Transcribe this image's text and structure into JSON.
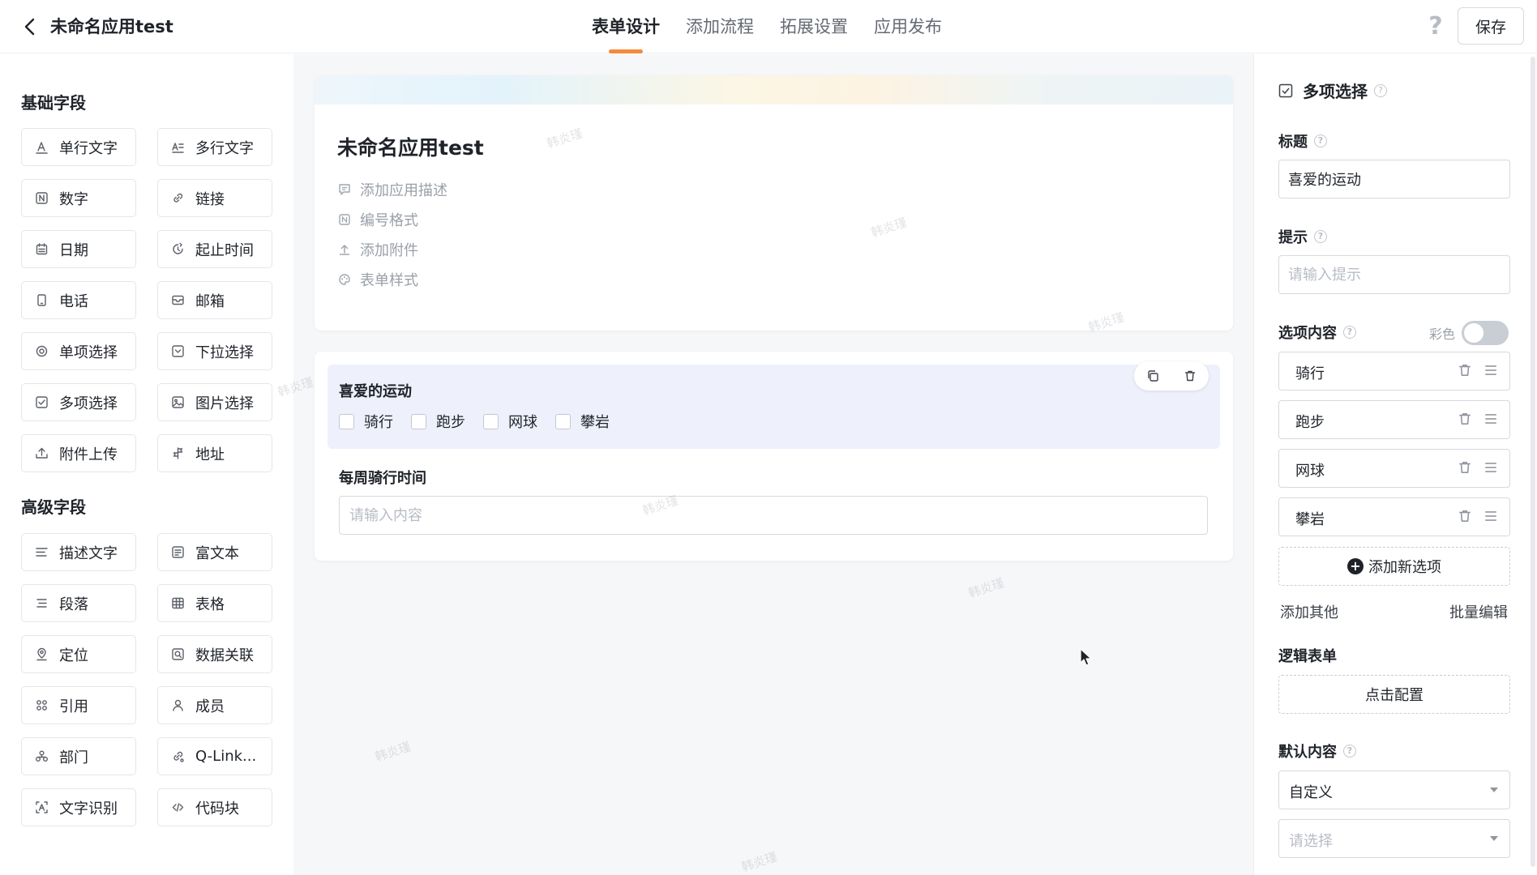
{
  "app": {
    "title": "未命名应用test"
  },
  "tabs": [
    {
      "label": "表单设计",
      "active": true
    },
    {
      "label": "添加流程",
      "active": false
    },
    {
      "label": "拓展设置",
      "active": false
    },
    {
      "label": "应用发布",
      "active": false
    }
  ],
  "toolbar": {
    "help": "?",
    "save_label": "保存"
  },
  "left": {
    "basic_title": "基础字段",
    "basic_fields": [
      {
        "label": "单行文字",
        "icon": "single-line-text-icon"
      },
      {
        "label": "多行文字",
        "icon": "multi-line-text-icon"
      },
      {
        "label": "数字",
        "icon": "number-icon"
      },
      {
        "label": "链接",
        "icon": "link-icon"
      },
      {
        "label": "日期",
        "icon": "calendar-icon"
      },
      {
        "label": "起止时间",
        "icon": "time-range-icon"
      },
      {
        "label": "电话",
        "icon": "phone-icon"
      },
      {
        "label": "邮箱",
        "icon": "mail-icon"
      },
      {
        "label": "单项选择",
        "icon": "radio-icon"
      },
      {
        "label": "下拉选择",
        "icon": "dropdown-icon"
      },
      {
        "label": "多项选择",
        "icon": "checkbox-icon"
      },
      {
        "label": "图片选择",
        "icon": "image-icon"
      },
      {
        "label": "附件上传",
        "icon": "upload-icon"
      },
      {
        "label": "地址",
        "icon": "address-icon"
      }
    ],
    "advanced_title": "高级字段",
    "advanced_fields": [
      {
        "label": "描述文字",
        "icon": "description-icon"
      },
      {
        "label": "富文本",
        "icon": "rich-text-icon"
      },
      {
        "label": "段落",
        "icon": "paragraph-icon"
      },
      {
        "label": "表格",
        "icon": "table-icon"
      },
      {
        "label": "定位",
        "icon": "location-icon"
      },
      {
        "label": "数据关联",
        "icon": "data-link-icon"
      },
      {
        "label": "引用",
        "icon": "reference-icon"
      },
      {
        "label": "成员",
        "icon": "member-icon"
      },
      {
        "label": "部门",
        "icon": "department-icon"
      },
      {
        "label": "Q-Link...",
        "icon": "q-link-icon"
      },
      {
        "label": "文字识别",
        "icon": "ocr-icon"
      },
      {
        "label": "代码块",
        "icon": "code-icon"
      }
    ]
  },
  "canvas": {
    "form_title": "未命名应用test",
    "meta": [
      {
        "label": "添加应用描述",
        "icon": "comment-icon"
      },
      {
        "label": "编号格式",
        "icon": "number-format-icon"
      },
      {
        "label": "添加附件",
        "icon": "attachment-upload-icon"
      },
      {
        "label": "表单样式",
        "icon": "palette-icon"
      }
    ],
    "field1": {
      "label": "喜爱的运动",
      "options": [
        "骑行",
        "跑步",
        "网球",
        "攀岩"
      ]
    },
    "field2": {
      "label": "每周骑行时间",
      "placeholder": "请输入内容"
    },
    "watermark": "韩炎瑾"
  },
  "right": {
    "field_type": "多项选择",
    "title_label": "标题",
    "title_value": "喜爱的运动",
    "hint_label": "提示",
    "hint_placeholder": "请输入提示",
    "options_label": "选项内容",
    "color_label": "彩色",
    "color_on": false,
    "options": [
      "骑行",
      "跑步",
      "网球",
      "攀岩"
    ],
    "add_option": "添加新选项",
    "add_other": "添加其他",
    "batch_edit": "批量编辑",
    "logic_label": "逻辑表单",
    "logic_button": "点击配置",
    "default_label": "默认内容",
    "default_value": "自定义",
    "default_placeholder": "请选择"
  },
  "colors": {
    "accent": "#f58a3c",
    "canvas_bg": "#f6f7f9",
    "selected_bg": "#eef1fc"
  }
}
